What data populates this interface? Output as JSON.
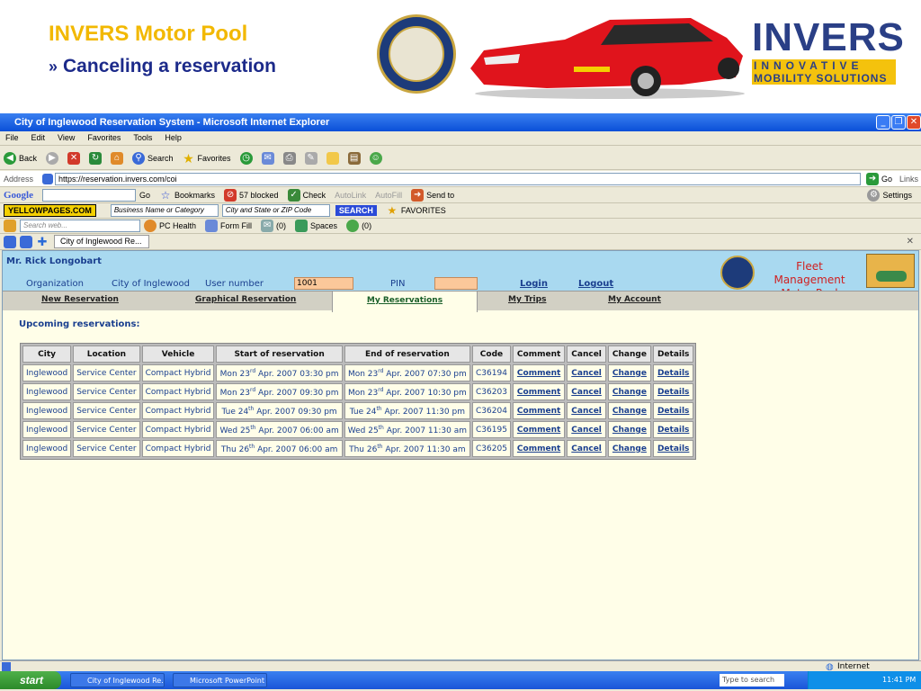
{
  "slide": {
    "title": "INVERS Motor Pool",
    "subtitle": "Canceling a reservation",
    "chevron": "»",
    "logo_main": "INVERS",
    "logo_tag1": "INNOVATIVE",
    "logo_tag2": "MOBILITY SOLUTIONS",
    "seal_icon": "city-seal-icon",
    "car_icon": "red-sports-car"
  },
  "window": {
    "title": "City of Inglewood Reservation System - Microsoft Internet Explorer"
  },
  "menu": [
    "File",
    "Edit",
    "View",
    "Favorites",
    "Tools",
    "Help"
  ],
  "toolbar": {
    "back": "Back",
    "search": "Search",
    "favorites": "Favorites"
  },
  "address": {
    "label": "Address",
    "url": "https://reservation.invers.com/coi",
    "go": "Go",
    "links": "Links"
  },
  "google": {
    "logo": "Google",
    "go": "Go",
    "bookmarks": "Bookmarks",
    "blocked": "57 blocked",
    "check": "Check",
    "autolink": "AutoLink",
    "autofill": "AutoFill",
    "sendto": "Send to",
    "settings": "Settings"
  },
  "yp": {
    "logo": "YELLOWPAGES.COM",
    "field1": "Business Name or Category",
    "field2": "City and State or ZIP Code",
    "search": "SEARCH",
    "favorites": "FAVORITES"
  },
  "ask": {
    "placeholder": "Search web...",
    "pchealth": "PC Health",
    "formfill": "Form Fill",
    "mail": "(0)",
    "spaces": "Spaces",
    "im": "(0)"
  },
  "tab": {
    "label": "City of Inglewood Re..."
  },
  "header": {
    "user": "Mr. Rick Longobart",
    "org_label": "Organization",
    "org_value": "City of Inglewood",
    "usernum_label": "User number",
    "usernum_value": "1001",
    "pin_label": "PIN",
    "login": "Login",
    "logout": "Logout",
    "fleet1": "Fleet Management",
    "fleet2": "Motor Pool"
  },
  "nav": {
    "new": "New Reservation",
    "graph": "Graphical Reservation",
    "mine": "My Reservations",
    "trips": "My Trips",
    "account": "My Account"
  },
  "table": {
    "title": "Upcoming reservations:",
    "headers": [
      "City",
      "Location",
      "Vehicle",
      "Start of reservation",
      "End of reservation",
      "Code",
      "Comment",
      "Cancel",
      "Change",
      "Details"
    ],
    "rows": [
      [
        "Inglewood",
        "Service Center",
        "Compact Hybrid",
        "Mon 23rd Apr. 2007 03:30 pm",
        "Mon 23rd Apr. 2007 07:30 pm",
        "C36194",
        "Comment",
        "Cancel",
        "Change",
        "Details"
      ],
      [
        "Inglewood",
        "Service Center",
        "Compact Hybrid",
        "Mon 23rd Apr. 2007 09:30 pm",
        "Mon 23rd Apr. 2007 10:30 pm",
        "C36203",
        "Comment",
        "Cancel",
        "Change",
        "Details"
      ],
      [
        "Inglewood",
        "Service Center",
        "Compact Hybrid",
        "Tue 24th Apr. 2007 09:30 pm",
        "Tue 24th Apr. 2007 11:30 pm",
        "C36204",
        "Comment",
        "Cancel",
        "Change",
        "Details"
      ],
      [
        "Inglewood",
        "Service Center",
        "Compact Hybrid",
        "Wed 25th Apr. 2007 06:00 am",
        "Wed 25th Apr. 2007 11:30 am",
        "C36195",
        "Comment",
        "Cancel",
        "Change",
        "Details"
      ],
      [
        "Inglewood",
        "Service Center",
        "Compact Hybrid",
        "Thu 26th Apr. 2007 06:00 am",
        "Thu 26th Apr. 2007 11:30 am",
        "C36205",
        "Comment",
        "Cancel",
        "Change",
        "Details"
      ]
    ]
  },
  "status": {
    "zone": "Internet"
  },
  "taskbar": {
    "start": "start",
    "task1": "City of Inglewood Re...",
    "task2": "Microsoft PowerPoint ...",
    "search": "Type to search",
    "time": "11:41 PM"
  }
}
